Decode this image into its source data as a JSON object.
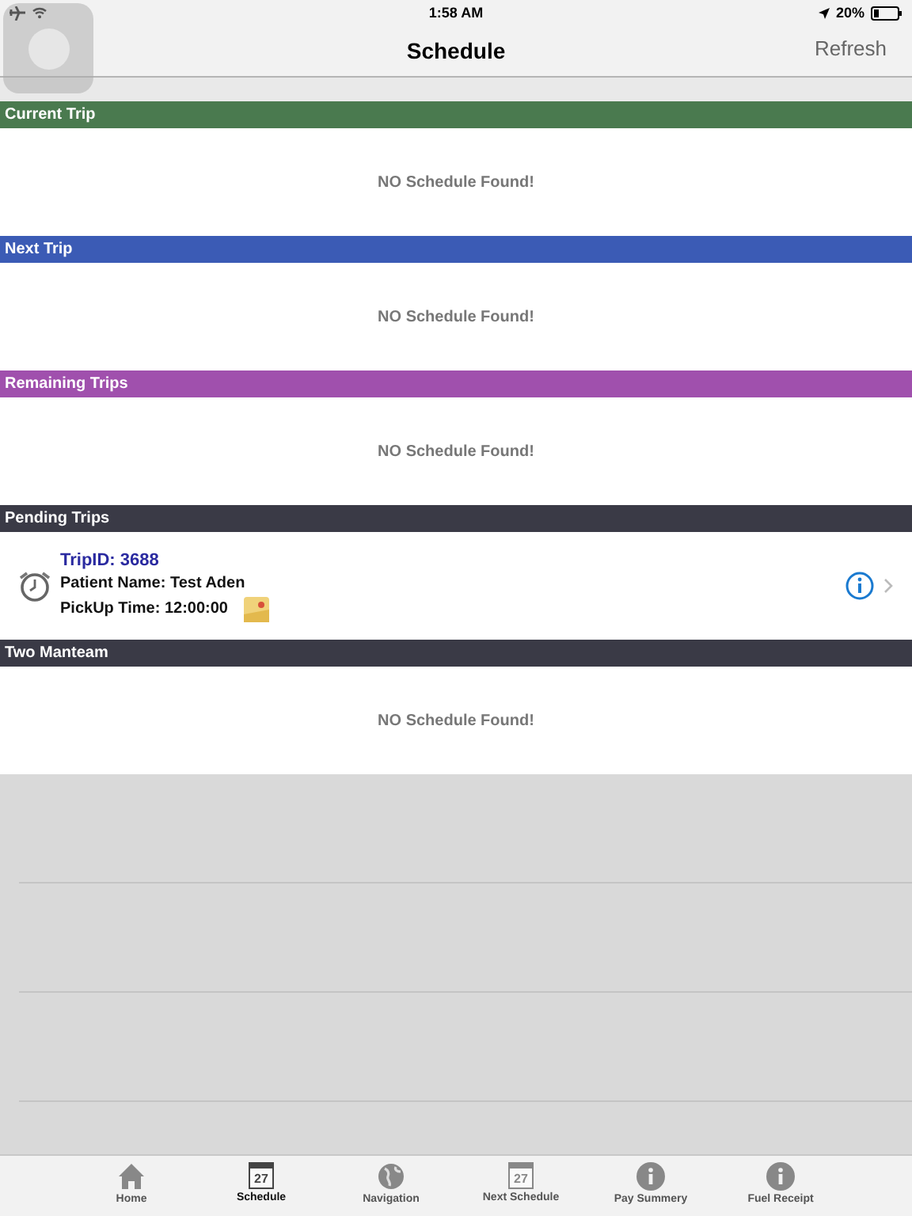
{
  "status_bar": {
    "time": "1:58 AM",
    "battery": "20%"
  },
  "nav": {
    "title": "Schedule",
    "right_button": "Refresh"
  },
  "sections": [
    {
      "title": "Current Trip",
      "color": "#4a7a4f",
      "kind": "empty",
      "message": "NO Schedule Found!"
    },
    {
      "title": "Next Trip",
      "color": "#3b5bb5",
      "kind": "empty",
      "message": "NO Schedule Found!"
    },
    {
      "title": "Remaining Trips",
      "color": "#a050ad",
      "kind": "empty",
      "message": "NO Schedule Found!"
    },
    {
      "title": "Pending Trips",
      "color": "#3a3a46",
      "kind": "trips",
      "trips": [
        {
          "trip_id": "TripID: 3688",
          "patient": "Patient Name: Test Aden",
          "pickup": "PickUp Time: 12:00:00"
        }
      ]
    },
    {
      "title": "Two Manteam",
      "color": "#3a3a46",
      "kind": "empty",
      "message": "NO Schedule Found!"
    }
  ],
  "tabs": [
    {
      "label": "Home",
      "kind": "home",
      "selected": false
    },
    {
      "label": "Schedule",
      "kind": "calendar",
      "date": "27",
      "selected": true
    },
    {
      "label": "Navigation",
      "kind": "globe",
      "selected": false
    },
    {
      "label": "Next Schedule",
      "kind": "calendar",
      "date": "27",
      "selected": false
    },
    {
      "label": "Pay Summery",
      "kind": "info",
      "selected": false
    },
    {
      "label": "Fuel Receipt",
      "kind": "info",
      "selected": false
    }
  ]
}
